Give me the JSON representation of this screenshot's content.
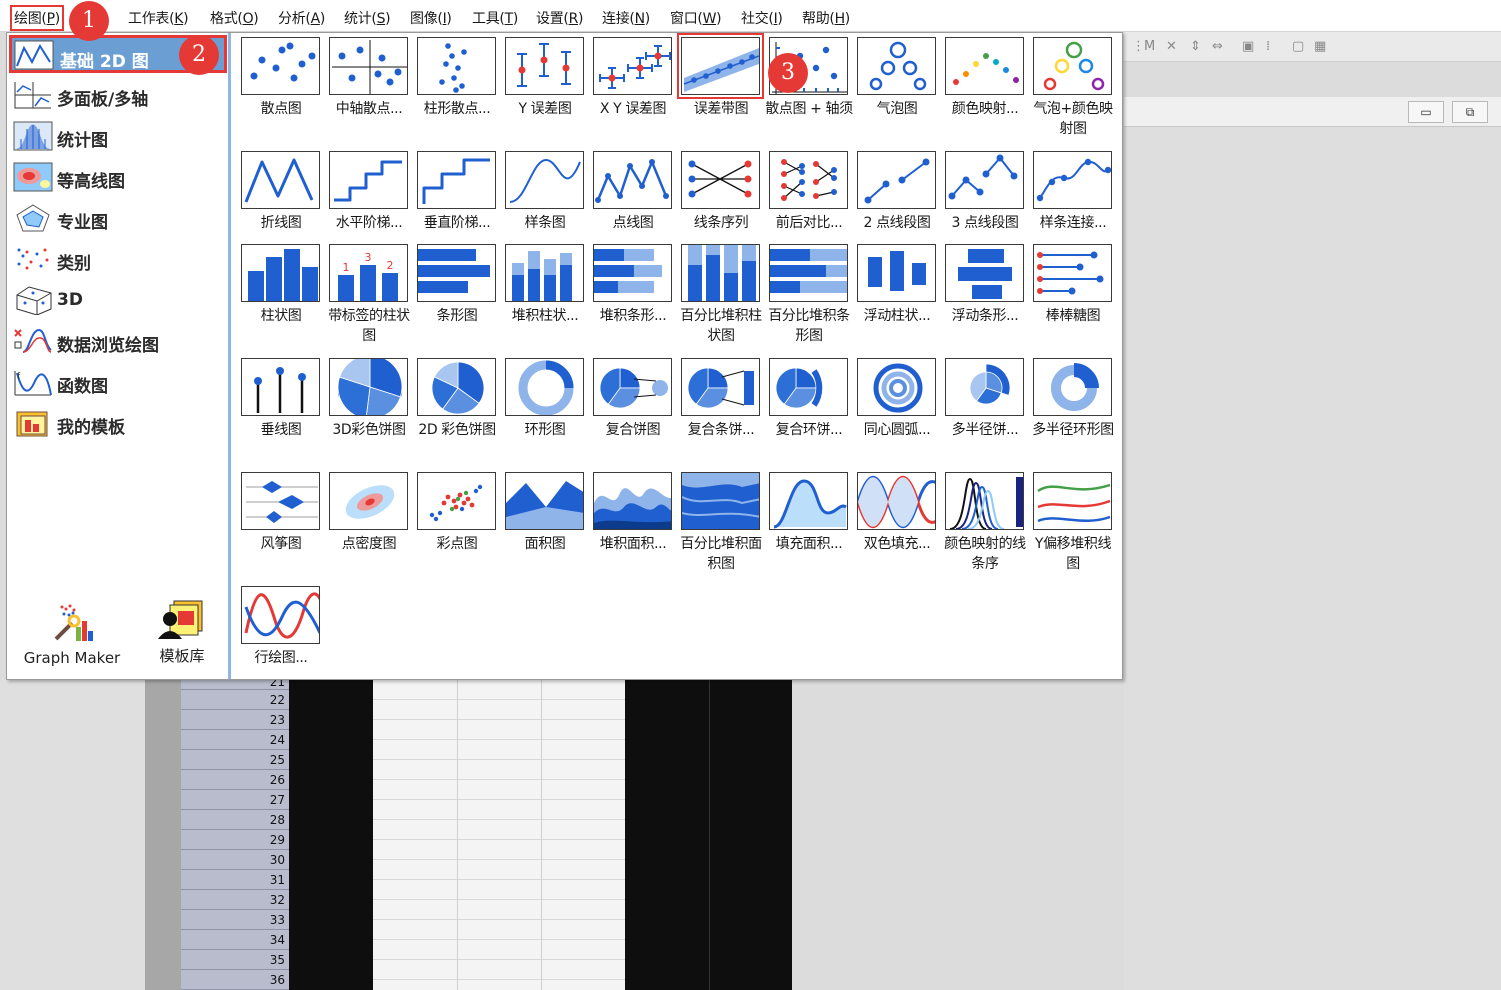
{
  "menubar": {
    "items": [
      {
        "label": "绘图(",
        "key": "P",
        "tail": ")"
      },
      {
        "label": "工作表(",
        "key": "K",
        "tail": ")"
      },
      {
        "label": "格式(",
        "key": "O",
        "tail": ")"
      },
      {
        "label": "分析(",
        "key": "A",
        "tail": ")"
      },
      {
        "label": "统计(",
        "key": "S",
        "tail": ")"
      },
      {
        "label": "图像(",
        "key": "I",
        "tail": ")"
      },
      {
        "label": "工具(",
        "key": "T",
        "tail": ")"
      },
      {
        "label": "设置(",
        "key": "R",
        "tail": ")"
      },
      {
        "label": "连接(",
        "key": "N",
        "tail": ")"
      },
      {
        "label": "窗口(",
        "key": "W",
        "tail": ")"
      },
      {
        "label": "社交(",
        "key": "I",
        "tail": ")"
      },
      {
        "label": "帮助(",
        "key": "H",
        "tail": ")"
      }
    ]
  },
  "categories": [
    {
      "label": "基础 2D 图",
      "icon": "line-chart-icon"
    },
    {
      "label": "多面板/多轴",
      "icon": "multi-panel-icon"
    },
    {
      "label": "统计图",
      "icon": "histogram-icon"
    },
    {
      "label": "等高线图",
      "icon": "contour-icon"
    },
    {
      "label": "专业图",
      "icon": "radar-icon"
    },
    {
      "label": "类别",
      "icon": "category-scatter-icon"
    },
    {
      "label": "3D",
      "icon": "cube-icon"
    },
    {
      "label": "数据浏览绘图",
      "icon": "data-explore-icon"
    },
    {
      "label": "函数图",
      "icon": "function-plot-icon"
    },
    {
      "label": "我的模板",
      "icon": "template-folder-icon"
    }
  ],
  "bottom_tools": {
    "graph_maker": "Graph Maker",
    "template_library": "模板库"
  },
  "graphs": [
    {
      "label": "散点图",
      "thumb": "scatter"
    },
    {
      "label": "中轴散点...",
      "thumb": "central-axis-scatter"
    },
    {
      "label": "柱形散点...",
      "thumb": "column-scatter"
    },
    {
      "label": "Y 误差图",
      "thumb": "y-error"
    },
    {
      "label": "X Y 误差图",
      "thumb": "xy-error"
    },
    {
      "label": "误差带图",
      "thumb": "error-band"
    },
    {
      "label": "散点图 + 轴须",
      "thumb": "scatter-rug"
    },
    {
      "label": "气泡图",
      "thumb": "bubble"
    },
    {
      "label": "颜色映射...",
      "thumb": "color-map-scatter"
    },
    {
      "label": "气泡+颜色映射图",
      "thumb": "bubble-color"
    },
    {
      "label": "折线图",
      "thumb": "line"
    },
    {
      "label": "水平阶梯...",
      "thumb": "h-step"
    },
    {
      "label": "垂直阶梯...",
      "thumb": "v-step"
    },
    {
      "label": "样条图",
      "thumb": "spline"
    },
    {
      "label": "点线图",
      "thumb": "line-symbol"
    },
    {
      "label": "线条序列",
      "thumb": "line-series"
    },
    {
      "label": "前后对比...",
      "thumb": "before-after"
    },
    {
      "label": "2 点线段图",
      "thumb": "two-point-segment"
    },
    {
      "label": "3 点线段图",
      "thumb": "three-point-segment"
    },
    {
      "label": "样条连接...",
      "thumb": "spline-connected"
    },
    {
      "label": "柱状图",
      "thumb": "column"
    },
    {
      "label": "带标签的柱状图",
      "thumb": "labeled-column"
    },
    {
      "label": "条形图",
      "thumb": "bar"
    },
    {
      "label": "堆积柱状...",
      "thumb": "stacked-column"
    },
    {
      "label": "堆积条形...",
      "thumb": "stacked-bar"
    },
    {
      "label": "百分比堆积柱状图",
      "thumb": "percent-stacked-column"
    },
    {
      "label": "百分比堆积条形图",
      "thumb": "percent-stacked-bar"
    },
    {
      "label": "浮动柱状...",
      "thumb": "floating-column"
    },
    {
      "label": "浮动条形...",
      "thumb": "floating-bar"
    },
    {
      "label": "棒棒糖图",
      "thumb": "lollipop"
    },
    {
      "label": "垂线图",
      "thumb": "drop-line"
    },
    {
      "label": "3D彩色饼图",
      "thumb": "pie-3d"
    },
    {
      "label": "2D 彩色饼图",
      "thumb": "pie-2d"
    },
    {
      "label": "环形图",
      "thumb": "doughnut"
    },
    {
      "label": "复合饼图",
      "thumb": "pie-of-pie"
    },
    {
      "label": "复合条饼...",
      "thumb": "bar-of-pie"
    },
    {
      "label": "复合环饼...",
      "thumb": "ring-of-pie"
    },
    {
      "label": "同心圆弧...",
      "thumb": "concentric-arc"
    },
    {
      "label": "多半径饼...",
      "thumb": "multi-radius-pie"
    },
    {
      "label": "多半径环形图",
      "thumb": "multi-radius-doughnut"
    },
    {
      "label": "风筝图",
      "thumb": "kite"
    },
    {
      "label": "点密度图",
      "thumb": "density-dots"
    },
    {
      "label": "彩点图",
      "thumb": "color-dots"
    },
    {
      "label": "面积图",
      "thumb": "area"
    },
    {
      "label": "堆积面积...",
      "thumb": "stacked-area"
    },
    {
      "label": "百分比堆积面积图",
      "thumb": "percent-stacked-area"
    },
    {
      "label": "填充面积...",
      "thumb": "fill-area"
    },
    {
      "label": "双色填充...",
      "thumb": "two-color-fill"
    },
    {
      "label": "颜色映射的线条序",
      "thumb": "color-mapped-series"
    },
    {
      "label": "Y偏移堆积线图",
      "thumb": "y-offset-stacked"
    },
    {
      "label": "行绘图...",
      "thumb": "plot-by-row"
    }
  ],
  "callouts": [
    "1",
    "2",
    "3"
  ],
  "row_numbers": [
    "21",
    "22",
    "23",
    "24",
    "25",
    "26",
    "27",
    "28",
    "29",
    "30",
    "31",
    "32",
    "33",
    "34",
    "35",
    "36"
  ],
  "window_buttons": {
    "minimize": "▭",
    "restore": "⧉"
  },
  "colors": {
    "accent": "#1f5fcf",
    "selected_category": "#6b9fd4",
    "callout": "#e53935"
  }
}
